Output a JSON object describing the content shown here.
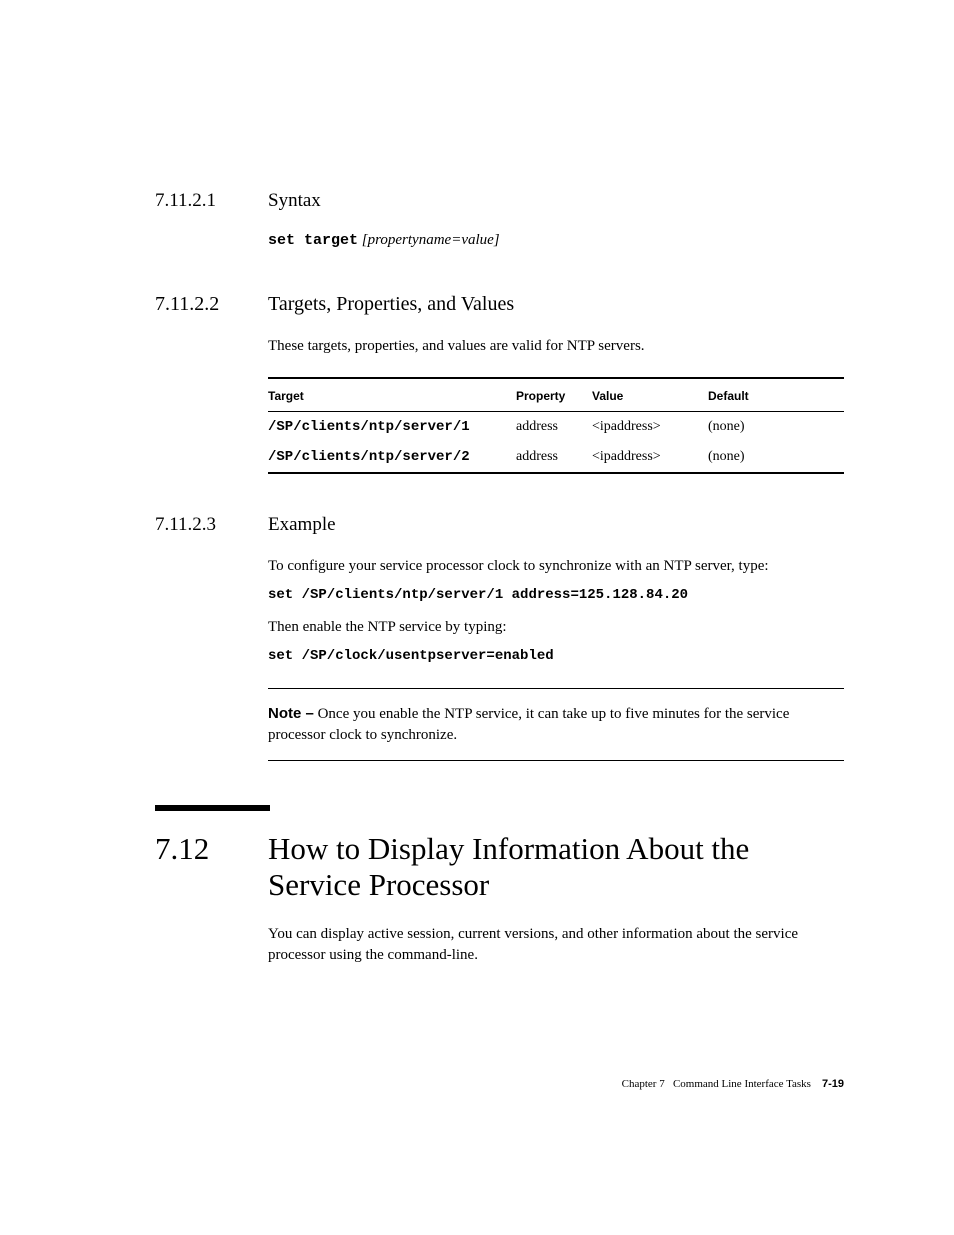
{
  "sec1": {
    "num": "7.11.2.1",
    "title": "Syntax",
    "cmd": "set target",
    "arg": "[propertyname=value]"
  },
  "sec2": {
    "num": "7.11.2.2",
    "title": "Targets, Properties, and Values",
    "para": "These targets, properties, and values are valid for NTP servers.",
    "thead": {
      "target": "Target",
      "property": "Property",
      "value": "Value",
      "default": "Default"
    },
    "rows": [
      {
        "target": "/SP/clients/ntp/server/1",
        "property": "address",
        "value": "<ipaddress>",
        "default": "(none)"
      },
      {
        "target": "/SP/clients/ntp/server/2",
        "property": "address",
        "value": "<ipaddress>",
        "default": "(none)"
      }
    ]
  },
  "sec3": {
    "num": "7.11.2.3",
    "title": "Example",
    "para1": "To configure your service processor clock to synchronize with an NTP server, type:",
    "cmd1": "set /SP/clients/ntp/server/1 address=125.128.84.20",
    "para2": "Then enable the NTP service by typing:",
    "cmd2": "set /SP/clock/usentpserver=enabled",
    "note_label": "Note –",
    "note_text": " Once you enable the NTP service, it can take up to five minutes for the service processor clock to synchronize."
  },
  "sec4": {
    "num": "7.12",
    "title": "How to Display Information About the Service Processor",
    "para": "You can display active session, current versions, and other information about the service processor using the command-line."
  },
  "footer": {
    "chapter": "Chapter 7",
    "title": "Command Line Interface Tasks",
    "page": "7-19"
  }
}
